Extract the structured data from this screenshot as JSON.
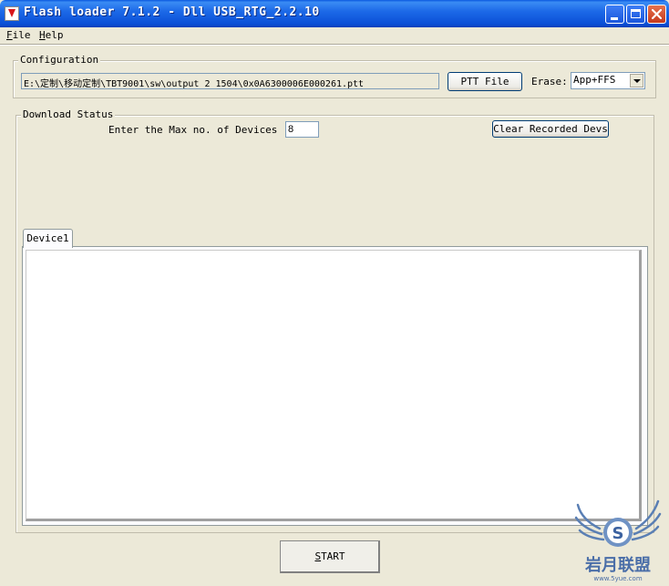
{
  "window": {
    "title": "Flash loader 7.1.2 - Dll USB_RTG_2.2.10"
  },
  "menu": {
    "file": "File",
    "help": "Help"
  },
  "configuration": {
    "group_label": "Configuration",
    "path": "E:\\定制\\移动定制\\TBT9001\\sw\\output_2_1504\\0x0A6300006E000261.ptt",
    "ptt_button": "PTT File",
    "erase_label": "Erase:",
    "erase_value": "App+FFS"
  },
  "download_status": {
    "group_label": "Download Status",
    "max_devices_label": "Enter the Max no. of Devices",
    "max_devices_value": "8",
    "clear_button": "Clear Recorded Devs",
    "tabs": [
      {
        "label": "Device1"
      }
    ]
  },
  "start_button": "START",
  "watermark": {
    "text": "岩月联盟",
    "url": "www.5yue.com"
  },
  "colors": {
    "titlebar": "#1d6ae8",
    "window_bg": "#ece9d8",
    "close_button": "#d44a2b"
  }
}
